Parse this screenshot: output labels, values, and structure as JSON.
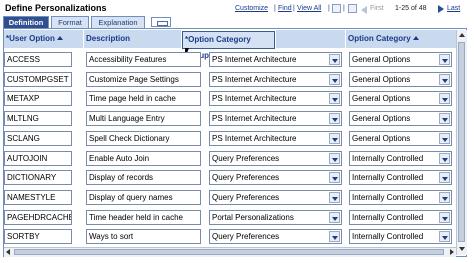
{
  "page": {
    "title": "Define Personalizations"
  },
  "toolbar": {
    "customize": "Customize",
    "find": "Find",
    "view_all": "View All",
    "first": "First",
    "range": "1-25 of 48",
    "last": "Last",
    "icons": [
      "download-grid-icon",
      "zoom-grid-icon",
      "previous-icon",
      "next-icon"
    ]
  },
  "tabs": [
    {
      "label": "Definition",
      "active": true
    },
    {
      "label": "Format",
      "active": false
    },
    {
      "label": "Explanation",
      "active": false
    }
  ],
  "columns": {
    "user_option": "*User Option",
    "description": "Description",
    "category_group": "*Option Category Group",
    "category": "Option Category"
  },
  "rows": [
    {
      "user_option": "ACCESS",
      "description": "Accessibility Features",
      "group": "PS Internet Architecture",
      "category": "General Options"
    },
    {
      "user_option": "CUSTOMPGSET",
      "description": "Customize Page Settings",
      "group": "PS Internet Architecture",
      "category": "General Options"
    },
    {
      "user_option": "METAXP",
      "description": "Time page held in cache",
      "group": "PS Internet Architecture",
      "category": "General Options"
    },
    {
      "user_option": "MLTLNG",
      "description": "Multi Language Entry",
      "group": "PS Internet Architecture",
      "category": "General Options"
    },
    {
      "user_option": "SCLANG",
      "description": "Spell Check Dictionary",
      "group": "PS Internet Architecture",
      "category": "General Options"
    },
    {
      "user_option": "AUTOJOIN",
      "description": "Enable Auto Join",
      "group": "Query Preferences",
      "category": "Internally Controlled"
    },
    {
      "user_option": "DICTIONARY",
      "description": "Display of records",
      "group": "Query Preferences",
      "category": "Internally Controlled"
    },
    {
      "user_option": "NAMESTYLE",
      "description": "Display of query names",
      "group": "Query Preferences",
      "category": "Internally Controlled"
    },
    {
      "user_option": "PAGEHDRCACHE",
      "description": "Time header held in cache",
      "group": "Portal Personalizations",
      "category": "Internally Controlled"
    },
    {
      "user_option": "SORTBY",
      "description": "Ways to sort",
      "group": "Query Preferences",
      "category": "Internally Controlled"
    }
  ],
  "colors": {
    "tab_active": "#2f4f8f",
    "header_bg": "#c9d9ee",
    "link": "#1a3b8a"
  }
}
